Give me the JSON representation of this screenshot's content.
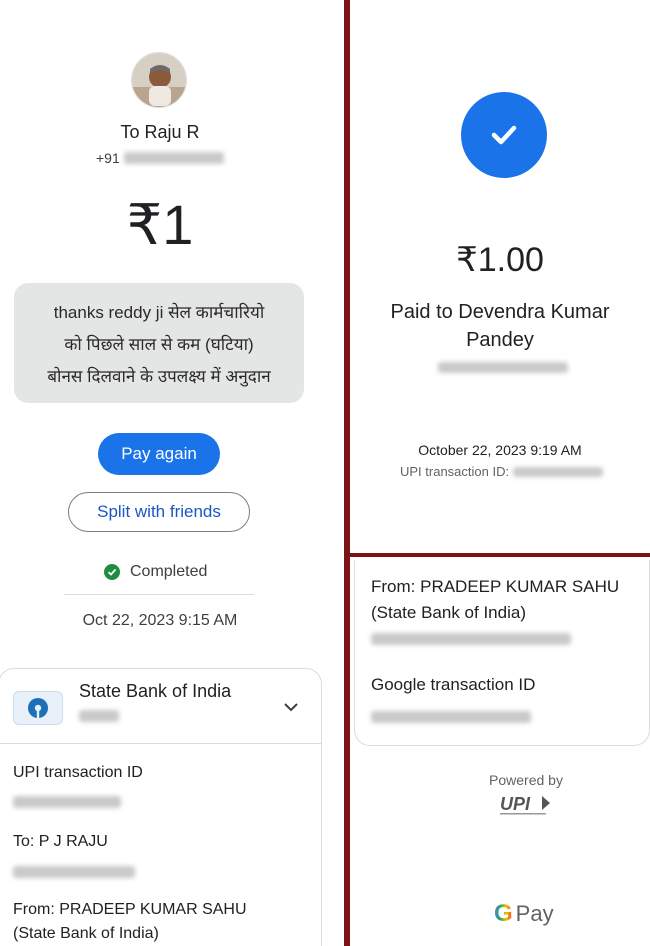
{
  "left": {
    "to_name": "To Raju R",
    "phone_prefix": "+91",
    "amount": "₹1",
    "note": [
      "thanks reddy ji सेल कार्मचारियो",
      "को पिछले साल से कम (घटिया)",
      "बोनस दिलवाने के उपलक्ष्य में अनुदान"
    ],
    "pay_again_label": "Pay again",
    "split_label": "Split with friends",
    "status": "Completed",
    "date": "Oct 22, 2023 9:15 AM",
    "bank": {
      "name": "State Bank of India",
      "icon": "chevron-down-icon"
    },
    "details": {
      "upi_txn_label": "UPI transaction ID",
      "to_label": "To: P J RAJU",
      "from_line1": "From: PRADEEP KUMAR SAHU",
      "from_line2": "(State Bank of India)"
    }
  },
  "right": {
    "amount": "₹1.00",
    "paid_to_line1": "Paid to Devendra Kumar",
    "paid_to_line2": "Pandey",
    "date": "October 22, 2023 9:19 AM",
    "txn_label": "UPI transaction ID:",
    "from_line1": "From: PRADEEP KUMAR SAHU",
    "from_line2": "(State Bank of India)",
    "google_txn_label": "Google transaction ID",
    "powered_by": "Powered by",
    "gpay_text": "Pay",
    "gpay_g": "G"
  },
  "colors": {
    "accent": "#1a73e8",
    "success": "#1e8e3e",
    "divider": "#7a1414"
  }
}
